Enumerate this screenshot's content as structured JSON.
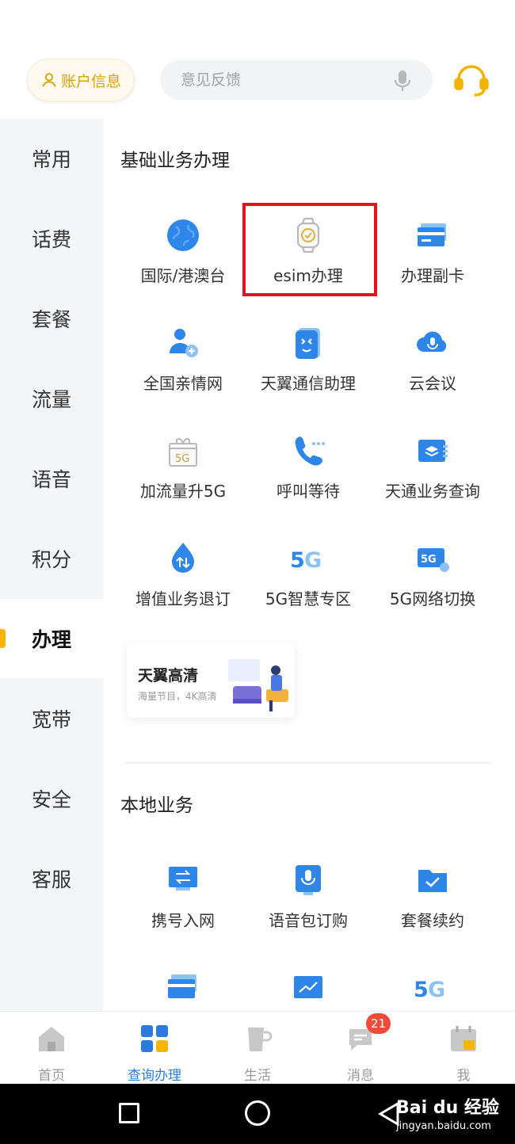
{
  "header": {
    "account_label": "账户信息",
    "search_placeholder": "意见反馈"
  },
  "sidebar": {
    "items": [
      {
        "label": "常用"
      },
      {
        "label": "话费"
      },
      {
        "label": "套餐"
      },
      {
        "label": "流量"
      },
      {
        "label": "语音"
      },
      {
        "label": "积分"
      },
      {
        "label": "办理",
        "active": true
      },
      {
        "label": "宽带"
      },
      {
        "label": "安全"
      },
      {
        "label": "客服"
      }
    ]
  },
  "basic": {
    "title": "基础业务办理",
    "items": [
      {
        "label": "国际/港澳台",
        "icon": "globe-icon"
      },
      {
        "label": "esim办理",
        "icon": "watch-icon"
      },
      {
        "label": "办理副卡",
        "icon": "card-icon"
      },
      {
        "label": "全国亲情网",
        "icon": "user-add-icon"
      },
      {
        "label": "天翼通信助理",
        "icon": "assistant-icon"
      },
      {
        "label": "云会议",
        "icon": "cloud-mic-icon"
      },
      {
        "label": "加流量升5G",
        "icon": "gift-5g-icon"
      },
      {
        "label": "呼叫等待",
        "icon": "phone-wait-icon"
      },
      {
        "label": "天通业务查询",
        "icon": "satellite-card-icon"
      },
      {
        "label": "增值业务退订",
        "icon": "drop-icon"
      },
      {
        "label": "5G智慧专区",
        "icon": "5g-icon"
      },
      {
        "label": "5G网络切换",
        "icon": "5g-switch-icon"
      }
    ]
  },
  "banner": {
    "title": "天翼高清",
    "subtitle": "海量节目，4K高清"
  },
  "local": {
    "title": "本地业务",
    "items": [
      {
        "label": "携号入网",
        "icon": "transfer-icon"
      },
      {
        "label": "语音包订购",
        "icon": "mic-icon"
      },
      {
        "label": "套餐续约",
        "icon": "folder-check-icon"
      }
    ]
  },
  "tabbar": {
    "items": [
      {
        "label": "首页",
        "icon": "home-icon"
      },
      {
        "label": "查询办理",
        "icon": "grid-icon",
        "active": true
      },
      {
        "label": "生活",
        "icon": "cup-icon"
      },
      {
        "label": "消息",
        "icon": "message-icon",
        "badge": "21"
      },
      {
        "label": "我",
        "icon": "calendar-user-icon"
      }
    ]
  },
  "watermark": {
    "logo": "Bai du 经验",
    "url": "jingyan.baidu.com"
  },
  "colors": {
    "accent": "#2b7bde",
    "brand_yellow": "#f5b500",
    "highlight_red": "#e3141e",
    "icon_blue": "#2e86e8"
  }
}
